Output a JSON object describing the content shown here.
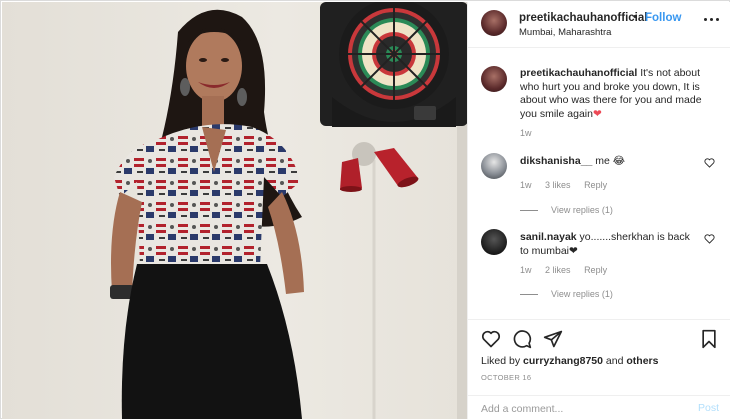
{
  "header": {
    "username": "preetikachauhanofficial",
    "separator": "•",
    "follow_label": "Follow",
    "location": "Mumbai, Maharashtra"
  },
  "caption": {
    "username": "preetikachauhanofficial",
    "text": "It's not about who hurt you and broke you down, It is about who was there for you and made you smile again",
    "emoji": "❤",
    "time": "1w"
  },
  "comments": [
    {
      "username": "dikshanisha__",
      "text": "me 😂",
      "time": "1w",
      "likes": "3 likes",
      "reply_label": "Reply",
      "view_replies": "View replies (1)"
    },
    {
      "username": "sanil.nayak",
      "text": "yo.......sherkhan is back to mumbai",
      "emoji": "❤",
      "time": "1w",
      "likes": "2 likes",
      "reply_label": "Reply",
      "view_replies": "View replies (1)"
    }
  ],
  "actions": {
    "liked_by_prefix": "Liked by",
    "liked_by_user": "curryzhang8750",
    "liked_by_and": "and",
    "liked_by_others": "others",
    "date": "OCTOBER 16"
  },
  "add_comment": {
    "placeholder": "Add a comment...",
    "post_label": "Post"
  },
  "icons": {
    "more": "more-horizontal-icon",
    "like": "heart-outline-icon",
    "comment": "comment-bubble-icon",
    "share": "paper-plane-icon",
    "save": "bookmark-icon"
  },
  "colors": {
    "link_blue": "#3897f0",
    "post_disabled": "#b2dffc",
    "muted": "#8e8e8e",
    "heart_red": "#ed4956"
  }
}
